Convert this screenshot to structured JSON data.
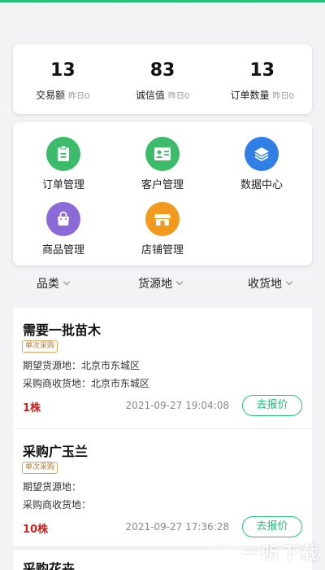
{
  "colors": {
    "accent": "#22c27a",
    "price": "#d0201a",
    "badge": "#b07a2a"
  },
  "stats": [
    {
      "value": "13",
      "label": "交易额",
      "yesterday": "昨日0"
    },
    {
      "value": "83",
      "label": "诚信值",
      "yesterday": "昨日0"
    },
    {
      "value": "13",
      "label": "订单数量",
      "yesterday": "昨日0"
    }
  ],
  "menu": [
    {
      "label": "订单管理",
      "icon": "clipboard-icon",
      "color": "#3cbb6b"
    },
    {
      "label": "客户管理",
      "icon": "id-card-icon",
      "color": "#3cbb6b"
    },
    {
      "label": "数据中心",
      "icon": "layers-icon",
      "color": "#2f7fe6"
    },
    {
      "label": "商品管理",
      "icon": "shopping-bag-icon",
      "color": "#8b6ad8"
    },
    {
      "label": "店铺管理",
      "icon": "store-icon",
      "color": "#f29a1e"
    }
  ],
  "filters": [
    "品类",
    "货源地",
    "收货地"
  ],
  "listings": [
    {
      "title": "需要一批苗木",
      "badge": "单次采购",
      "origin": "期望货源地：北京市东城区",
      "dest": "采购商收货地：北京市东城区",
      "qty": "1株",
      "time": "2021-09-27 19:04:08",
      "action": "去报价"
    },
    {
      "title": "采购广玉兰",
      "badge": "单次采购",
      "origin": "期望货源地：",
      "dest": "采购商收货地：",
      "qty": "10株",
      "time": "2021-09-27 17:36:28",
      "action": "去报价"
    },
    {
      "title": "采购花卉"
    }
  ],
  "watermark": {
    "mark": "听",
    "text": "一听下载"
  }
}
